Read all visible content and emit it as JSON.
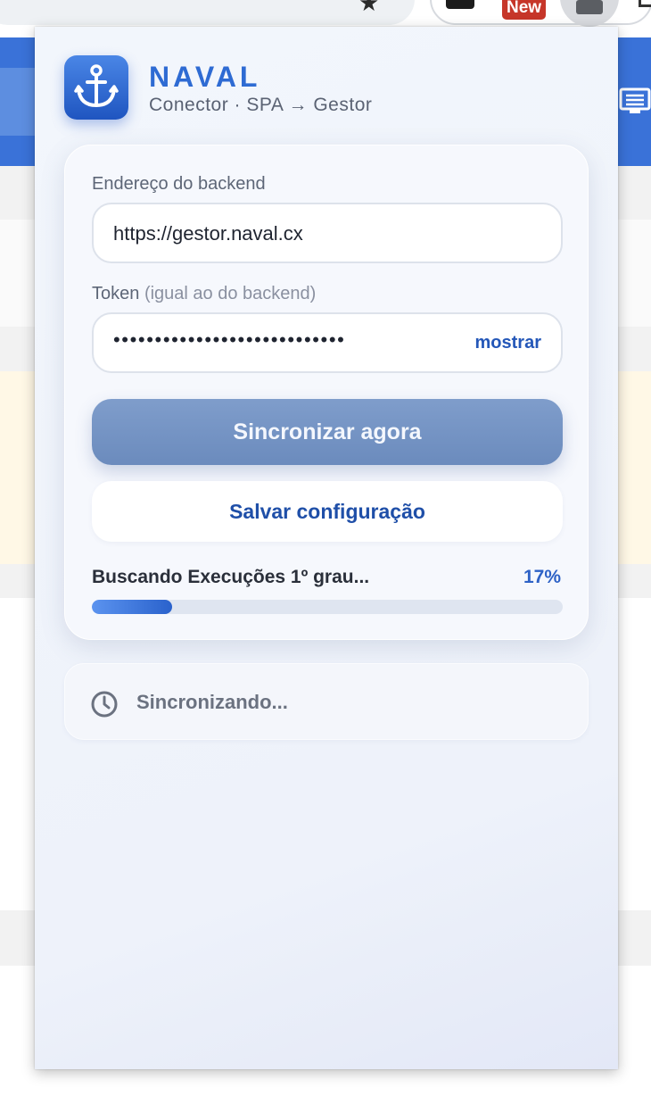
{
  "browser": {
    "new_badge": "New"
  },
  "popup": {
    "brand": {
      "title": "NAVAL",
      "subtitle": "Conector · SPA → Gestor",
      "logo_icon": "anchor-icon"
    },
    "backend": {
      "label": "Endereço do backend",
      "value": "https://gestor.naval.cx"
    },
    "token": {
      "label": "Token",
      "hint": "(igual ao do backend)",
      "masked_value": "••••••••••••••••••••••••••••",
      "toggle_label": "mostrar"
    },
    "buttons": {
      "sync_label": "Sincronizar agora",
      "save_label": "Salvar configuração"
    },
    "progress": {
      "text": "Buscando Execuções 1º grau...",
      "percent_label": "17%",
      "value": 0.17
    },
    "status": {
      "icon": "clock-icon",
      "text": "Sincronizando..."
    }
  },
  "colors": {
    "accent": "#2e6bd3",
    "sync_button": "#7591c4",
    "progress_fill": "#3a72d8"
  }
}
